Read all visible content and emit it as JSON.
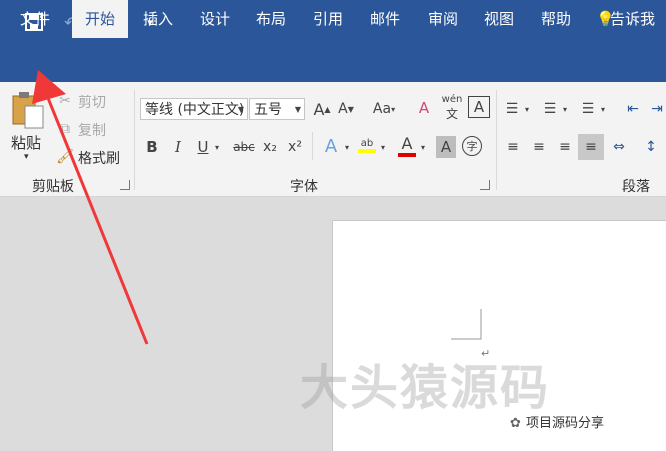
{
  "quick_access": {
    "save_icon": "save-icon",
    "undo_icon": "undo-icon",
    "redo_icon": "redo-icon",
    "customize_icon": "customize-icon"
  },
  "tabs": [
    {
      "label": "文件"
    },
    {
      "label": "开始",
      "active": true
    },
    {
      "label": "插入"
    },
    {
      "label": "设计"
    },
    {
      "label": "布局"
    },
    {
      "label": "引用"
    },
    {
      "label": "邮件"
    },
    {
      "label": "审阅"
    },
    {
      "label": "视图"
    },
    {
      "label": "帮助"
    }
  ],
  "tell_me": "告诉我",
  "clipboard": {
    "paste": "粘贴",
    "cut": "剪切",
    "copy": "复制",
    "format_painter": "格式刷",
    "group_label": "剪贴板"
  },
  "font": {
    "font_name": "等线 (中文正文)",
    "font_size": "五号",
    "clear_format_glyph": "A",
    "case_glyph": "Aa",
    "phonetic_glyph": "wén",
    "char_border_glyph": "A",
    "bold": "B",
    "italic": "I",
    "underline": "U",
    "strikethrough": "abc",
    "subscript": "x₂",
    "superscript": "x²",
    "text_effect_glyph": "A",
    "highlight_glyph": "ab",
    "font_color_glyph": "A",
    "char_shading_glyph": "A",
    "enclose_char_glyph": "字",
    "group_label": "字体"
  },
  "paragraph": {
    "group_label": "段落"
  },
  "watermark_text": "大头猿源码",
  "source_label": "项目源码分享",
  "colors": {
    "ribbon_blue": "#2b579a",
    "font_color_red": "#e00000",
    "highlight_yellow": "#ffff00",
    "arrow_red": "#f03838"
  }
}
